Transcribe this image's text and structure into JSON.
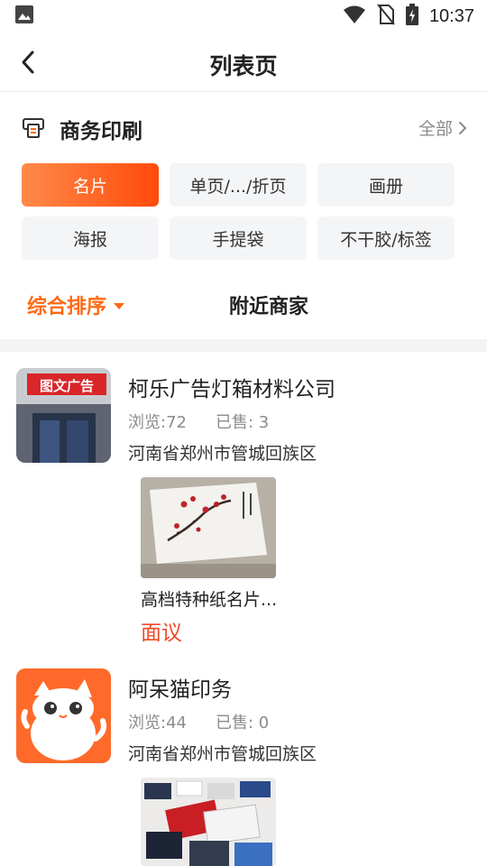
{
  "status_bar": {
    "time": "10:37",
    "left_icon": "image-icon",
    "right_icons": [
      "wifi-icon",
      "no-sim-icon",
      "battery-charging-icon"
    ]
  },
  "header": {
    "title": "列表页",
    "back_icon": "chevron-left-icon"
  },
  "section": {
    "icon": "printer-icon",
    "title": "商务印刷",
    "all_label": "全部"
  },
  "categories": [
    {
      "label": "名片",
      "active": true
    },
    {
      "label": "单页/.../折页",
      "active": false
    },
    {
      "label": "画册",
      "active": false
    },
    {
      "label": "海报",
      "active": false
    },
    {
      "label": "手提袋",
      "active": false
    },
    {
      "label": "不干胶/标签",
      "active": false
    }
  ],
  "sort": {
    "main_label": "综合排序",
    "nearby_label": "附近商家"
  },
  "shops": [
    {
      "name": "柯乐广告灯箱材料公司",
      "views": "浏览:72",
      "sold": "已售: 3",
      "address": "河南省郑州市管城回族区",
      "logo_text": "图文广告",
      "product": {
        "name": "高档特种纸名片...",
        "price": "面议"
      }
    },
    {
      "name": "阿呆猫印务",
      "views": "浏览:44",
      "sold": "已售: 0",
      "address": "河南省郑州市管城回族区",
      "product": {
        "name": "",
        "price": ""
      }
    }
  ],
  "colors": {
    "accent": "#ff6a13",
    "price": "#f04a2c",
    "chip_bg": "#f4f5f7"
  }
}
